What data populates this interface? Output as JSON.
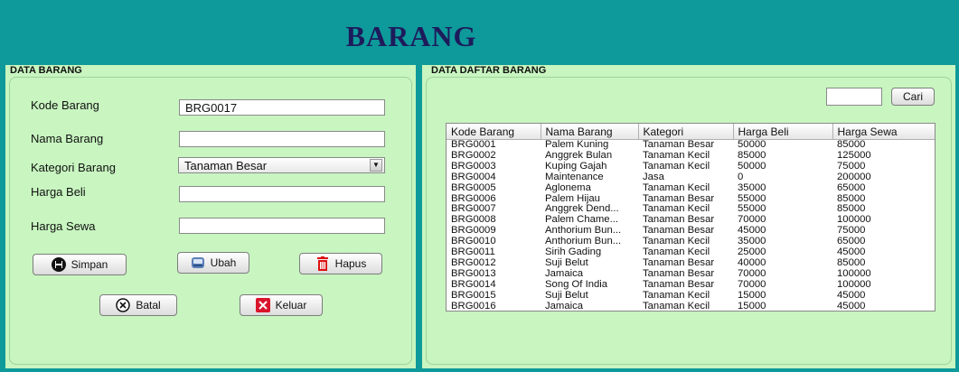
{
  "app_title": "BARANG",
  "left_panel": {
    "heading": "DATA BARANG",
    "fields": {
      "kode_label": "Kode Barang",
      "kode_value": "BRG0017",
      "nama_label": "Nama Barang",
      "nama_value": "",
      "kategori_label": "Kategori Barang",
      "kategori_value": "Tanaman Besar",
      "beli_label": "Harga Beli",
      "beli_value": "",
      "sewa_label": "Harga Sewa",
      "sewa_value": ""
    },
    "buttons": {
      "simpan": "Simpan",
      "ubah": "Ubah",
      "hapus": "Hapus",
      "batal": "Batal",
      "keluar": "Keluar"
    }
  },
  "right_panel": {
    "heading": "DATA DAFTAR BARANG",
    "search_value": "",
    "search_button": "Cari",
    "table": {
      "columns": [
        "Kode Barang",
        "Nama Barang",
        "Kategori",
        "Harga Beli",
        "Harga Sewa"
      ],
      "rows": [
        [
          "BRG0001",
          "Palem Kuning",
          "Tanaman Besar",
          "50000",
          "85000"
        ],
        [
          "BRG0002",
          "Anggrek Bulan",
          "Tanaman Kecil",
          "85000",
          "125000"
        ],
        [
          "BRG0003",
          "Kuping Gajah",
          "Tanaman Kecil",
          "50000",
          "75000"
        ],
        [
          "BRG0004",
          "Maintenance",
          "Jasa",
          "0",
          "200000"
        ],
        [
          "BRG0005",
          "Aglonema",
          "Tanaman Kecil",
          "35000",
          "65000"
        ],
        [
          "BRG0006",
          "Palem Hijau",
          "Tanaman Besar",
          "55000",
          "85000"
        ],
        [
          "BRG0007",
          "Anggrek Dend...",
          "Tanaman Kecil",
          "55000",
          "85000"
        ],
        [
          "BRG0008",
          "Palem Chame...",
          "Tanaman Besar",
          "70000",
          "100000"
        ],
        [
          "BRG0009",
          "Anthorium Bun...",
          "Tanaman Besar",
          "45000",
          "75000"
        ],
        [
          "BRG0010",
          "Anthorium Bun...",
          "Tanaman Kecil",
          "35000",
          "65000"
        ],
        [
          "BRG0011",
          "Sirih Gading",
          "Tanaman Kecil",
          "25000",
          "45000"
        ],
        [
          "BRG0012",
          "Suji Belut",
          "Tanaman Besar",
          "40000",
          "85000"
        ],
        [
          "BRG0013",
          "Jamaica",
          "Tanaman Besar",
          "70000",
          "100000"
        ],
        [
          "BRG0014",
          "Song Of India",
          "Tanaman Besar",
          "70000",
          "100000"
        ],
        [
          "BRG0015",
          "Suji Belut",
          "Tanaman Kecil",
          "15000",
          "45000"
        ],
        [
          "BRG0016",
          "Jamaica",
          "Tanaman Kecil",
          "15000",
          "45000"
        ]
      ]
    }
  },
  "colors": {
    "background": "#0e9a9a",
    "panel": "#c8f5c0",
    "title": "#1d1b5c"
  },
  "icons": {
    "simpan": "save-icon",
    "ubah": "edit-icon",
    "hapus": "trash-icon",
    "batal": "cancel-icon",
    "keluar": "close-icon"
  }
}
